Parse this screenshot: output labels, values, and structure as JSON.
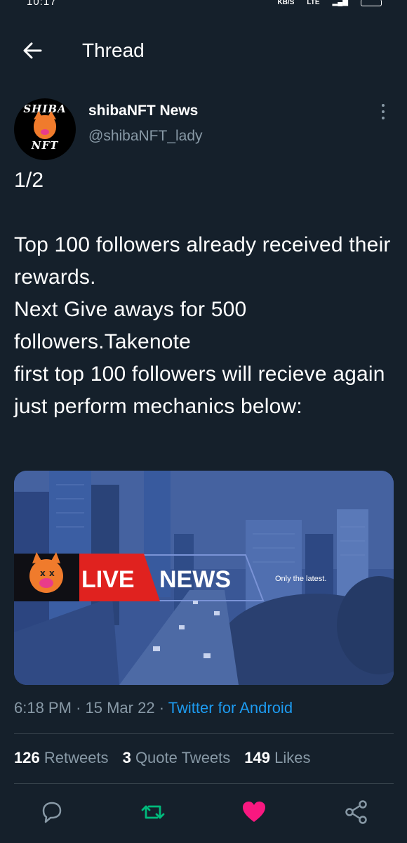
{
  "status_bar": {
    "time": "10:17",
    "speed": "KB/S",
    "network": "LTE"
  },
  "app_bar": {
    "title": "Thread",
    "back_icon": "arrow-left-icon"
  },
  "tweet": {
    "author": {
      "display_name": "shibaNFT News",
      "handle": "@shibaNFT_lady",
      "avatar_text_top": "SHIBA",
      "avatar_text_bottom": "NFT"
    },
    "text": "1/2\n\nTop 100 followers already received their rewards.\nNext Give aways for 500 followers.Takenote\nfirst top 100 followers will recieve again just perform mechanics below:",
    "media": {
      "live_label": "LIVE",
      "news_label": "NEWS",
      "tagline": "Only the latest."
    },
    "time": "6:18 PM",
    "date": "15 Mar 22",
    "source": "Twitter for Android",
    "separator": "·",
    "stats": {
      "retweets_count": "126",
      "retweets_label": "Retweets",
      "quote_count": "3",
      "quote_label": "Quote Tweets",
      "likes_count": "149",
      "likes_label": "Likes"
    }
  },
  "actions": {
    "reply_icon": "reply-icon",
    "retweet_icon": "retweet-icon",
    "like_icon": "heart-icon",
    "share_icon": "share-icon"
  },
  "colors": {
    "background": "#15202b",
    "secondary_text": "#8899a6",
    "link": "#1d9bf0",
    "retweet_green": "#00ba7c",
    "like_pink": "#f91880",
    "live_red": "#e0221f",
    "media_blue": "#34508c"
  }
}
